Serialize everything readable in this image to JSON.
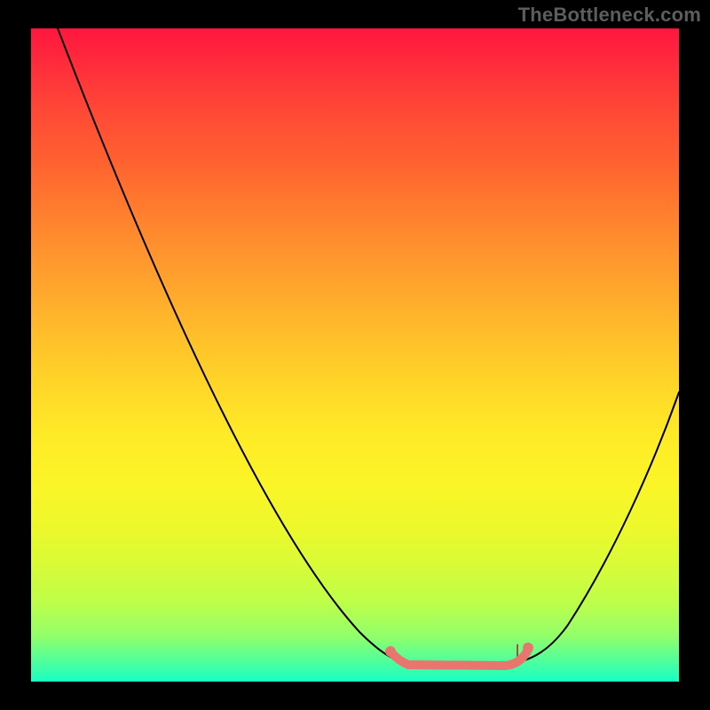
{
  "watermark": "TheBottleneck.com",
  "colors": {
    "gradient_top": "#ff163f",
    "gradient_bottom": "#17ffc5",
    "curve": "#000000",
    "emphasis": "#e9766e",
    "frame": "#000000",
    "watermark": "#5d5d5d"
  },
  "chart_data": {
    "type": "line",
    "title": "",
    "xlabel": "",
    "ylabel": "",
    "xlim": [
      0,
      100
    ],
    "ylim": [
      0,
      100
    ],
    "description": "Bottleneck-style V curve: percentage error vs. configuration. Background gradient runs red (high, bad) to green (low, good). Pink segment marks the low-bottleneck valley.",
    "series": [
      {
        "name": "left_branch",
        "values": [
          {
            "x": 4,
            "y": 100
          },
          {
            "x": 15,
            "y": 70
          },
          {
            "x": 27,
            "y": 45
          },
          {
            "x": 40,
            "y": 22
          },
          {
            "x": 50,
            "y": 8
          },
          {
            "x": 55,
            "y": 4
          },
          {
            "x": 58,
            "y": 3
          }
        ]
      },
      {
        "name": "valley_flat",
        "values": [
          {
            "x": 58,
            "y": 3
          },
          {
            "x": 62,
            "y": 2.5
          },
          {
            "x": 68,
            "y": 2.5
          },
          {
            "x": 74,
            "y": 3
          }
        ]
      },
      {
        "name": "right_branch",
        "values": [
          {
            "x": 74,
            "y": 3
          },
          {
            "x": 78,
            "y": 6
          },
          {
            "x": 83,
            "y": 14
          },
          {
            "x": 90,
            "y": 30
          },
          {
            "x": 100,
            "y": 44
          }
        ]
      },
      {
        "name": "optimal_region_highlight",
        "values": [
          {
            "x": 55,
            "y": 5
          },
          {
            "x": 58,
            "y": 3
          },
          {
            "x": 66,
            "y": 2.5
          },
          {
            "x": 73,
            "y": 3
          },
          {
            "x": 77,
            "y": 5
          }
        ]
      }
    ]
  }
}
